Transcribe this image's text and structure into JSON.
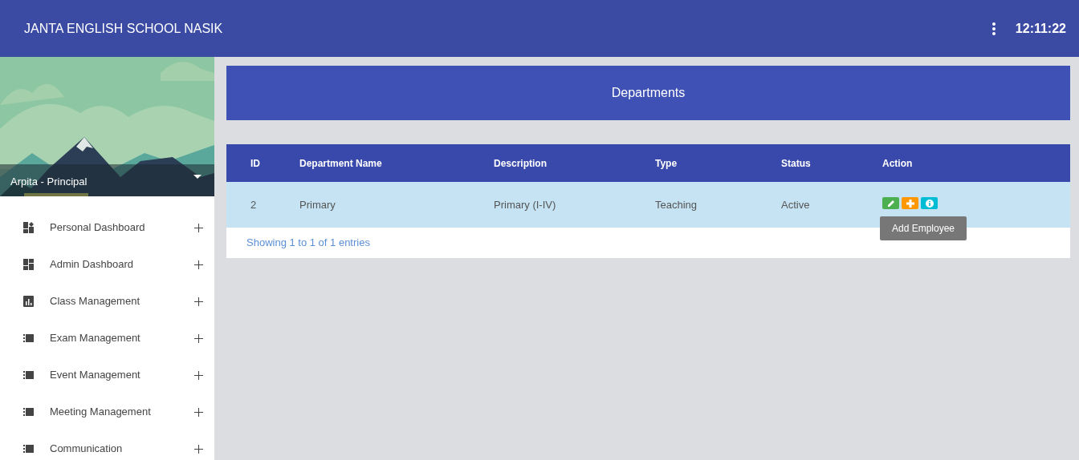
{
  "app_bar": {
    "title": "JANTA ENGLISH SCHOOL NASIK",
    "time": "12:11:22"
  },
  "sidebar": {
    "user": "Arpita - Principal",
    "items": [
      {
        "label": "Personal Dashboard",
        "kind": "personal"
      },
      {
        "label": "Admin Dashboard",
        "kind": "dashboard"
      },
      {
        "label": "Class Management",
        "kind": "chart"
      },
      {
        "label": "Exam Management",
        "kind": "list"
      },
      {
        "label": "Event Management",
        "kind": "list"
      },
      {
        "label": "Meeting Management",
        "kind": "list"
      },
      {
        "label": "Communication",
        "kind": "list"
      }
    ]
  },
  "page_title": "Departments",
  "table": {
    "columns": [
      "ID",
      "Department Name",
      "Description",
      "Type",
      "Status",
      "Action"
    ],
    "rows": [
      {
        "cells": [
          "2",
          "Primary",
          "Primary (I-IV)",
          "Teaching",
          "Active"
        ],
        "selected": true,
        "actions": [
          {
            "kind": "edit",
            "color": "#4caf50"
          },
          {
            "kind": "add",
            "color": "#ff9800",
            "tooltip": "Add Employee"
          },
          {
            "kind": "info",
            "color": "#00bcd4"
          }
        ]
      }
    ],
    "footer": "Showing 1 to 1 of 1 entries"
  }
}
